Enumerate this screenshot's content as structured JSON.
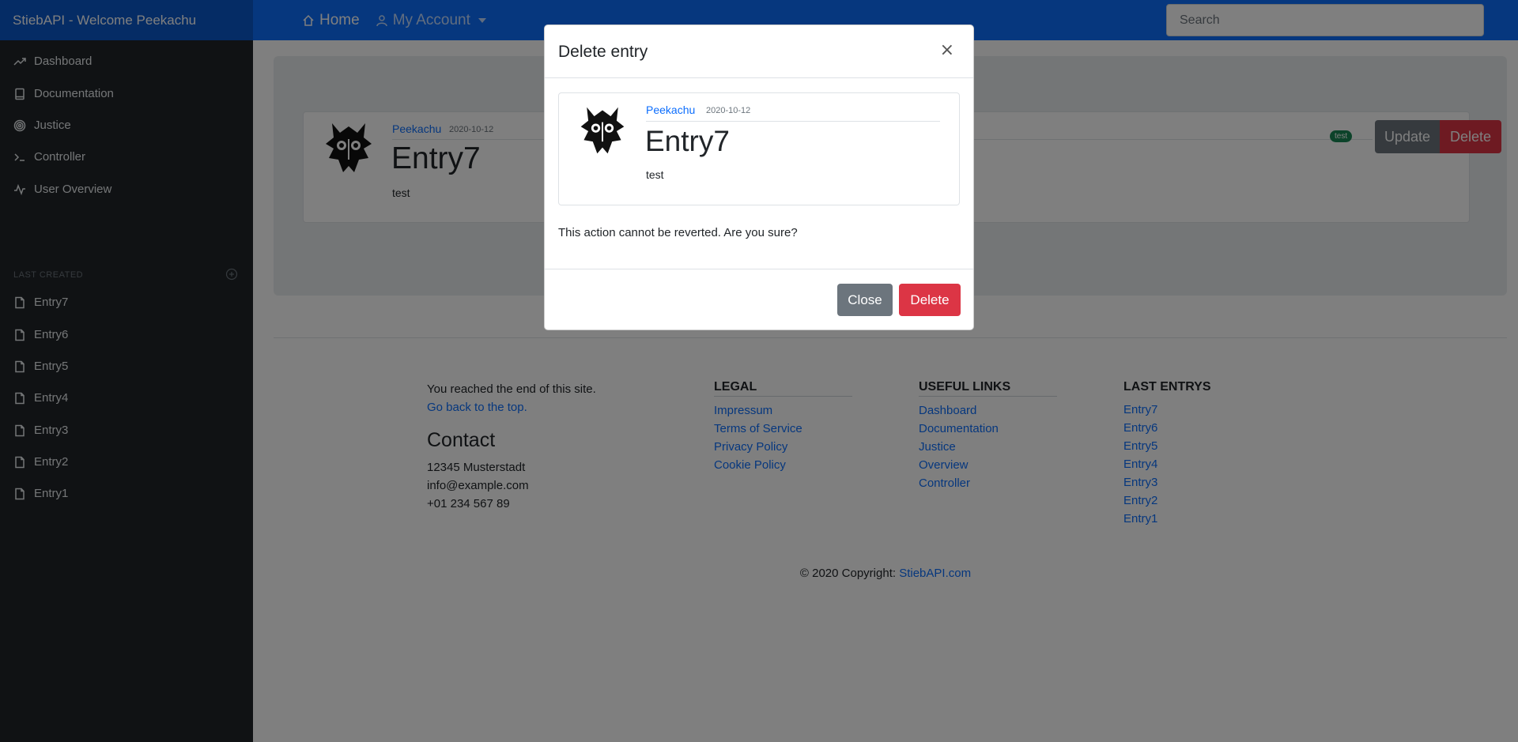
{
  "navbar": {
    "brand": "StiebAPI - Welcome Peekachu",
    "home": "Home",
    "account": "My Account",
    "search_placeholder": "Search"
  },
  "sidebar": {
    "items": [
      {
        "label": "Dashboard",
        "icon": "trending-up-icon"
      },
      {
        "label": "Documentation",
        "icon": "book-icon"
      },
      {
        "label": "Justice",
        "icon": "target-icon"
      },
      {
        "label": "Controller",
        "icon": "terminal-icon"
      },
      {
        "label": "User Overview",
        "icon": "activity-icon"
      }
    ],
    "last_created_heading": "LAST CREATED",
    "entries": [
      "Entry7",
      "Entry6",
      "Entry5",
      "Entry4",
      "Entry3",
      "Entry2",
      "Entry1"
    ]
  },
  "entry": {
    "author": "Peekachu",
    "date": "2020-10-12",
    "title": "Entry7",
    "text": "test",
    "tag": "test",
    "update_label": "Update",
    "delete_label": "Delete"
  },
  "footer": {
    "end_text": "You reached the end of this site.",
    "back_top": "Go back to the top.",
    "contact_heading": "Contact",
    "contact_lines": [
      "12345 Musterstadt",
      "info@example.com",
      "+01 234 567 89"
    ],
    "legal_heading": "LEGAL",
    "legal_links": [
      "Impressum",
      "Terms of Service",
      "Privacy Policy",
      "Cookie Policy"
    ],
    "useful_heading": "USEFUL LINKS",
    "useful_links": [
      "Dashboard",
      "Documentation",
      "Justice",
      "Overview",
      "Controller"
    ],
    "last_heading": "LAST ENTRYS",
    "last_links": [
      "Entry7",
      "Entry6",
      "Entry5",
      "Entry4",
      "Entry3",
      "Entry2",
      "Entry1"
    ],
    "copyright_prefix": "© 2020 Copyright:",
    "copyright_link": "StiebAPI.com"
  },
  "modal": {
    "title": "Delete entry",
    "close_x": "×",
    "entry_author": "Peekachu",
    "entry_date": "2020-10-12",
    "entry_title": "Entry7",
    "entry_text": "test",
    "warning": "This action cannot be reverted. Are you sure?",
    "close_label": "Close",
    "delete_label": "Delete"
  },
  "colors": {
    "primary": "#0d6efd",
    "danger": "#dc3545",
    "secondary": "#6c757d",
    "sidebar_bg": "#212529",
    "success": "#198754"
  }
}
